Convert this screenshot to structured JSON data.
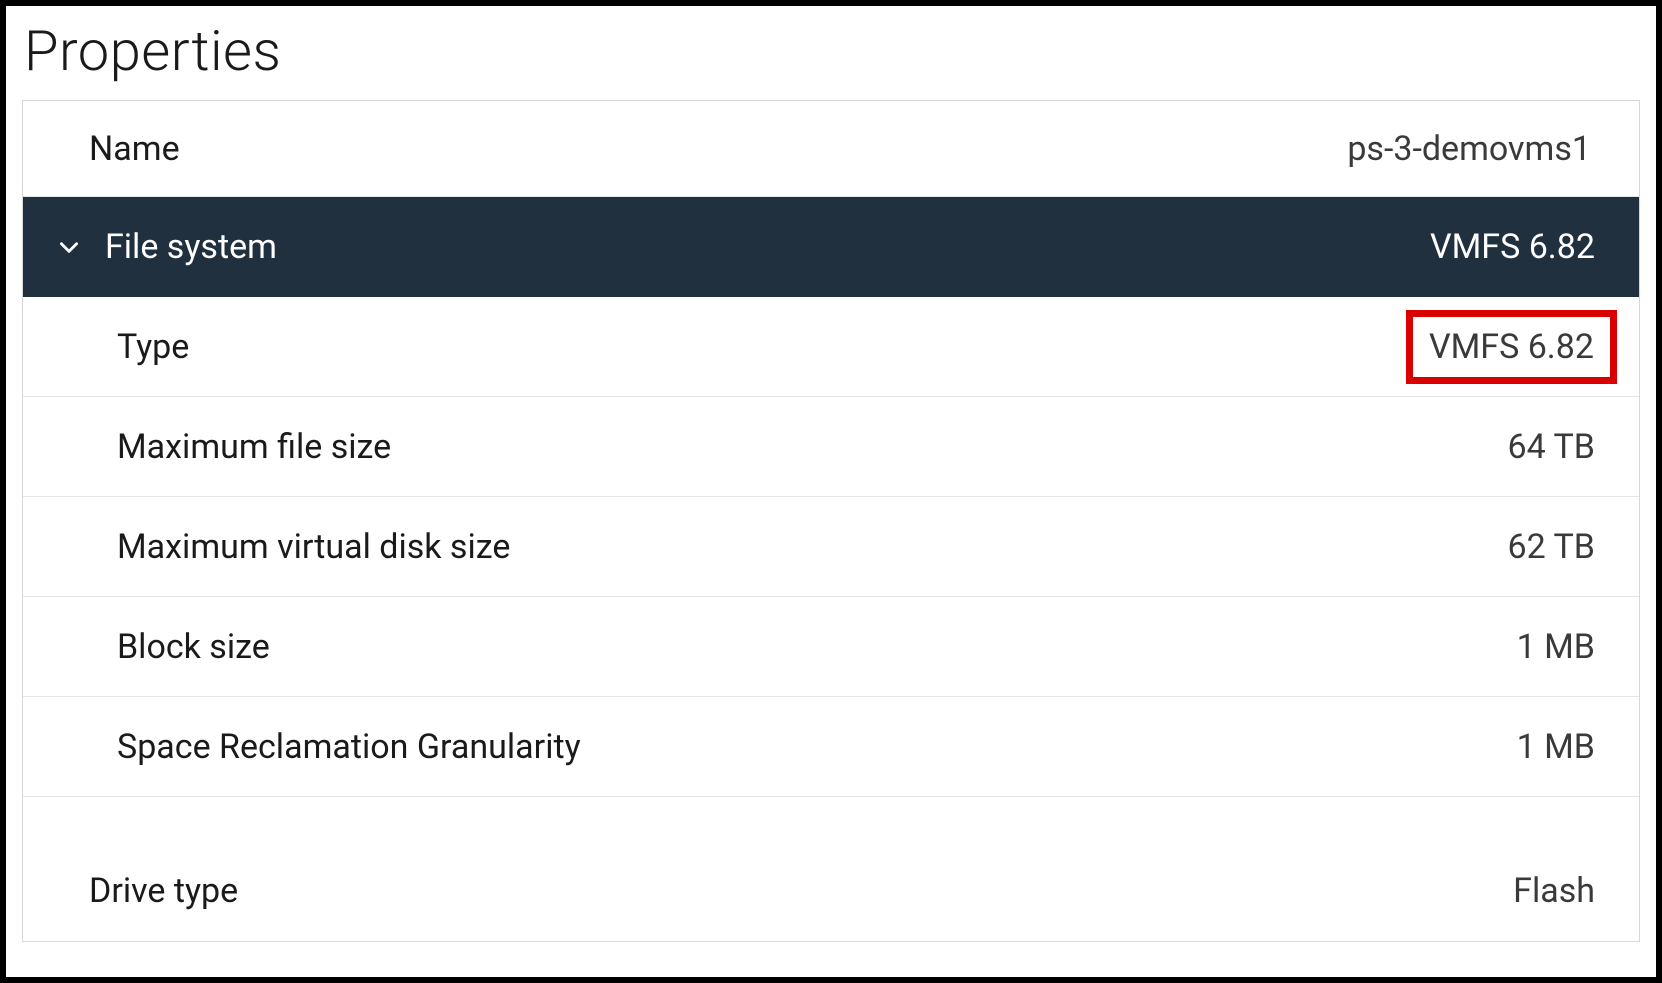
{
  "panel": {
    "title": "Properties"
  },
  "rows": {
    "name": {
      "label": "Name",
      "value": "ps-3-demovms1"
    },
    "filesystem_header": {
      "label": "File system",
      "value": "VMFS 6.82"
    },
    "type": {
      "label": "Type",
      "value": "VMFS 6.82"
    },
    "max_file_size": {
      "label": "Maximum file size",
      "value": "64 TB"
    },
    "max_vdisk_size": {
      "label": "Maximum virtual disk size",
      "value": "62 TB"
    },
    "block_size": {
      "label": "Block size",
      "value": "1 MB"
    },
    "space_reclamation": {
      "label": "Space Reclamation Granularity",
      "value": "1 MB"
    },
    "drive_type": {
      "label": "Drive type",
      "value": "Flash"
    }
  }
}
